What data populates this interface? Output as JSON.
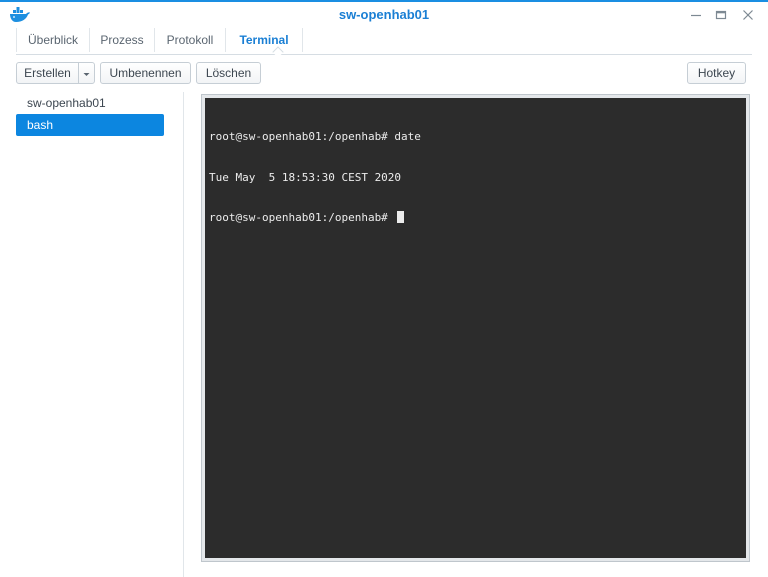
{
  "window": {
    "title": "sw-openhab01",
    "app_icon": "docker-whale-icon",
    "controls": [
      "minimize-icon",
      "maximize-icon",
      "close-icon"
    ],
    "accent_color": "#1a8ee2"
  },
  "tabs": [
    {
      "label": "Überblick",
      "active": false
    },
    {
      "label": "Prozess",
      "active": false
    },
    {
      "label": "Protokoll",
      "active": false
    },
    {
      "label": "Terminal",
      "active": true
    }
  ],
  "toolbar": {
    "create_label": "Erstellen",
    "rename_label": "Umbenennen",
    "delete_label": "Löschen",
    "hotkey_label": "Hotkey"
  },
  "sidebar": {
    "items": [
      {
        "label": "sw-openhab01",
        "selected": false
      },
      {
        "label": "bash",
        "selected": true
      }
    ],
    "selected_color": "#0c86e0"
  },
  "terminal": {
    "lines": [
      "root@sw-openhab01:/openhab# date",
      "Tue May  5 18:53:30 CEST 2020",
      "root@sw-openhab01:/openhab# "
    ],
    "background": "#2c2c2c",
    "foreground": "#ececec"
  }
}
